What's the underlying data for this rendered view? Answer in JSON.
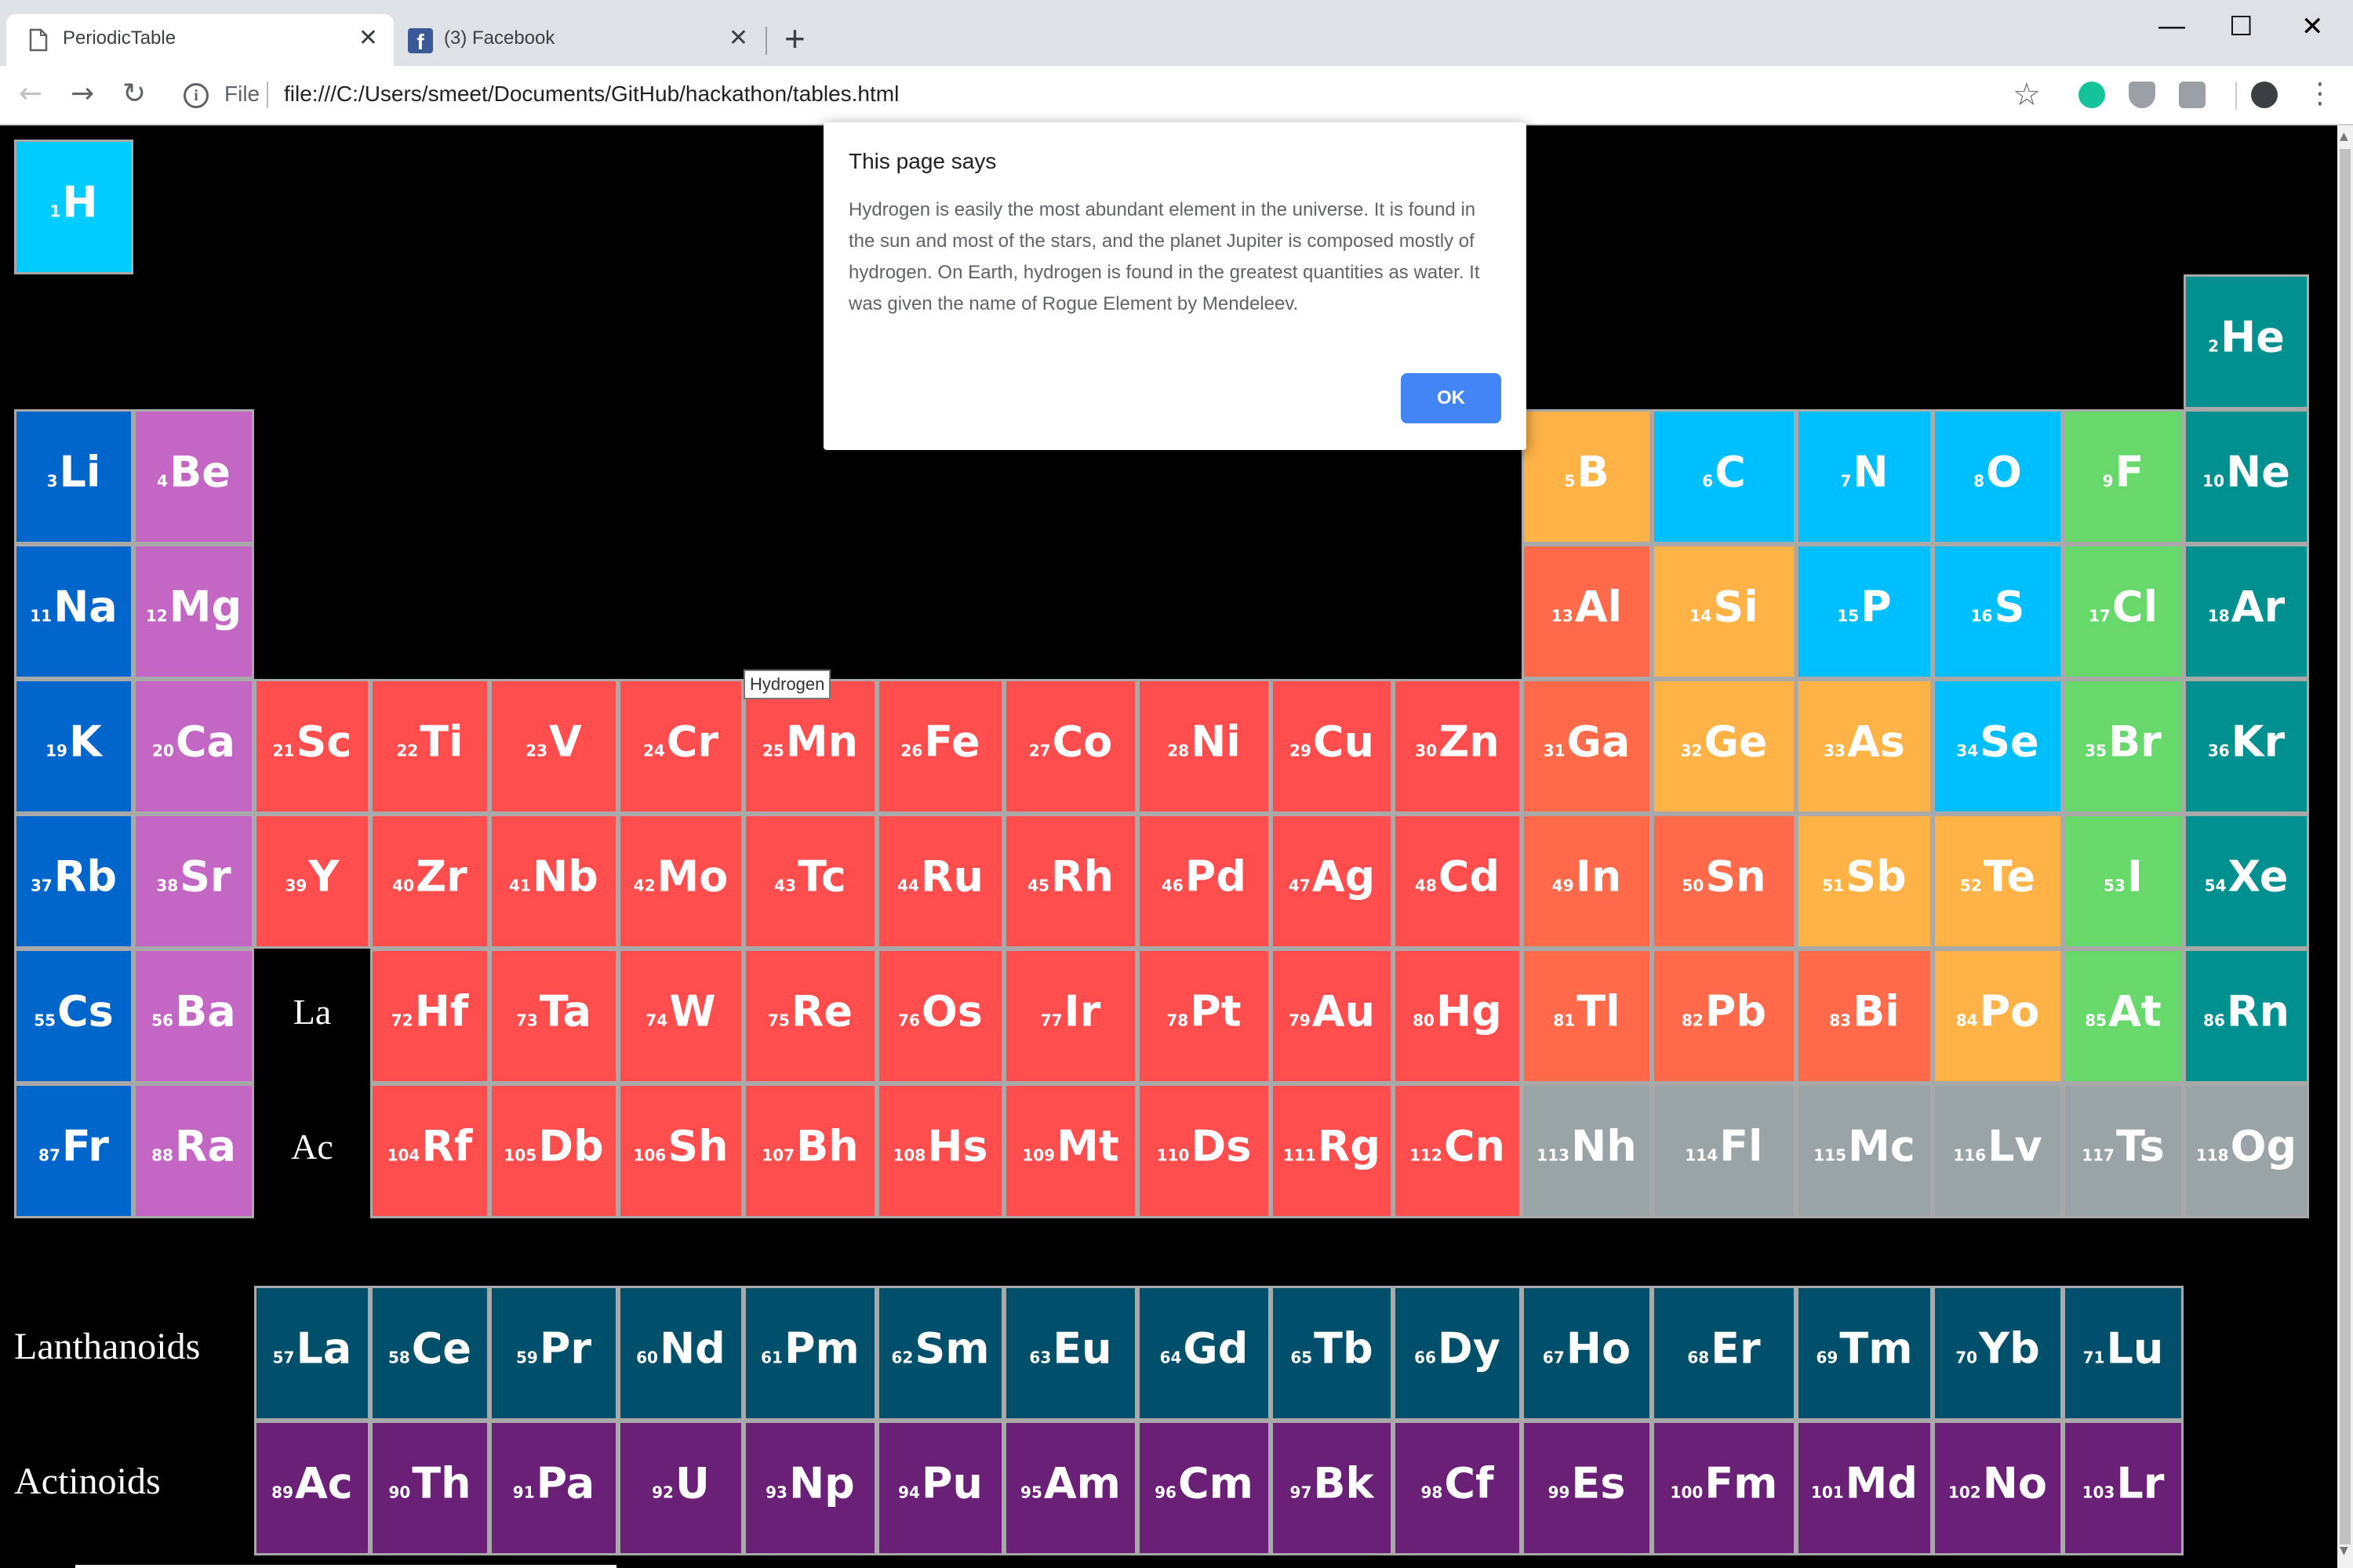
{
  "browser": {
    "tabs": [
      {
        "label": "PeriodicTable",
        "icon": "document-icon",
        "active": true
      },
      {
        "label": "(3) Facebook",
        "icon": "facebook-icon",
        "active": false
      }
    ],
    "new_tab": "+",
    "window_controls": {
      "minimize": "—",
      "maximize": "☐",
      "close": "✕"
    },
    "nav": {
      "back": "←",
      "forward": "→",
      "reload": "↻"
    },
    "address": {
      "scheme_label": "File",
      "url": "file:///C:/Users/smeet/Documents/GitHub/hackathon/tables.html"
    },
    "bookmark_star": "☆",
    "extensions": [
      "grammarly-icon",
      "shield-icon",
      "camera-icon",
      "profile-icon"
    ],
    "menu": "⋮"
  },
  "colors": {
    "alkali": "#0066cc",
    "alkaline": "#c466c4",
    "transition": "#ff4d4d",
    "post_transition": "#ff6b4a",
    "metalloid": "#ffb347",
    "nonmetal": "#00bfff",
    "halogen": "#66d96a",
    "noble": "#009090",
    "unknown": "#9aa3a6",
    "lanthanoid": "#00506b",
    "actinoid": "#6b2077",
    "hydrogen": "#00ccff"
  },
  "table": {
    "main": [
      {
        "row": 1,
        "col": 1,
        "n": "1",
        "s": "H",
        "c": "hydrogen"
      },
      {
        "row": 2,
        "col": 18,
        "n": "2",
        "s": "He",
        "c": "noble"
      },
      {
        "row": 3,
        "col": 1,
        "n": "3",
        "s": "Li",
        "c": "alkali"
      },
      {
        "row": 3,
        "col": 2,
        "n": "4",
        "s": "Be",
        "c": "alkaline"
      },
      {
        "row": 3,
        "col": 13,
        "n": "5",
        "s": "B",
        "c": "metalloid"
      },
      {
        "row": 3,
        "col": 14,
        "n": "6",
        "s": "C",
        "c": "nonmetal"
      },
      {
        "row": 3,
        "col": 15,
        "n": "7",
        "s": "N",
        "c": "nonmetal"
      },
      {
        "row": 3,
        "col": 16,
        "n": "8",
        "s": "O",
        "c": "nonmetal"
      },
      {
        "row": 3,
        "col": 17,
        "n": "9",
        "s": "F",
        "c": "halogen"
      },
      {
        "row": 3,
        "col": 18,
        "n": "10",
        "s": "Ne",
        "c": "noble"
      },
      {
        "row": 4,
        "col": 1,
        "n": "11",
        "s": "Na",
        "c": "alkali"
      },
      {
        "row": 4,
        "col": 2,
        "n": "12",
        "s": "Mg",
        "c": "alkaline"
      },
      {
        "row": 4,
        "col": 13,
        "n": "13",
        "s": "Al",
        "c": "post_transition"
      },
      {
        "row": 4,
        "col": 14,
        "n": "14",
        "s": "Si",
        "c": "metalloid"
      },
      {
        "row": 4,
        "col": 15,
        "n": "15",
        "s": "P",
        "c": "nonmetal"
      },
      {
        "row": 4,
        "col": 16,
        "n": "16",
        "s": "S",
        "c": "nonmetal"
      },
      {
        "row": 4,
        "col": 17,
        "n": "17",
        "s": "Cl",
        "c": "halogen"
      },
      {
        "row": 4,
        "col": 18,
        "n": "18",
        "s": "Ar",
        "c": "noble"
      },
      {
        "row": 5,
        "col": 1,
        "n": "19",
        "s": "K",
        "c": "alkali"
      },
      {
        "row": 5,
        "col": 2,
        "n": "20",
        "s": "Ca",
        "c": "alkaline"
      },
      {
        "row": 5,
        "col": 3,
        "n": "21",
        "s": "Sc",
        "c": "transition"
      },
      {
        "row": 5,
        "col": 4,
        "n": "22",
        "s": "Ti",
        "c": "transition"
      },
      {
        "row": 5,
        "col": 5,
        "n": "23",
        "s": "V",
        "c": "transition"
      },
      {
        "row": 5,
        "col": 6,
        "n": "24",
        "s": "Cr",
        "c": "transition"
      },
      {
        "row": 5,
        "col": 7,
        "n": "25",
        "s": "Mn",
        "c": "transition"
      },
      {
        "row": 5,
        "col": 8,
        "n": "26",
        "s": "Fe",
        "c": "transition"
      },
      {
        "row": 5,
        "col": 9,
        "n": "27",
        "s": "Co",
        "c": "transition"
      },
      {
        "row": 5,
        "col": 10,
        "n": "28",
        "s": "Ni",
        "c": "transition"
      },
      {
        "row": 5,
        "col": 11,
        "n": "29",
        "s": "Cu",
        "c": "transition"
      },
      {
        "row": 5,
        "col": 12,
        "n": "30",
        "s": "Zn",
        "c": "transition"
      },
      {
        "row": 5,
        "col": 13,
        "n": "31",
        "s": "Ga",
        "c": "post_transition"
      },
      {
        "row": 5,
        "col": 14,
        "n": "32",
        "s": "Ge",
        "c": "metalloid"
      },
      {
        "row": 5,
        "col": 15,
        "n": "33",
        "s": "As",
        "c": "metalloid"
      },
      {
        "row": 5,
        "col": 16,
        "n": "34",
        "s": "Se",
        "c": "nonmetal"
      },
      {
        "row": 5,
        "col": 17,
        "n": "35",
        "s": "Br",
        "c": "halogen"
      },
      {
        "row": 5,
        "col": 18,
        "n": "36",
        "s": "Kr",
        "c": "noble"
      },
      {
        "row": 6,
        "col": 1,
        "n": "37",
        "s": "Rb",
        "c": "alkali"
      },
      {
        "row": 6,
        "col": 2,
        "n": "38",
        "s": "Sr",
        "c": "alkaline"
      },
      {
        "row": 6,
        "col": 3,
        "n": "39",
        "s": "Y",
        "c": "transition"
      },
      {
        "row": 6,
        "col": 4,
        "n": "40",
        "s": "Zr",
        "c": "transition"
      },
      {
        "row": 6,
        "col": 5,
        "n": "41",
        "s": "Nb",
        "c": "transition"
      },
      {
        "row": 6,
        "col": 6,
        "n": "42",
        "s": "Mo",
        "c": "transition"
      },
      {
        "row": 6,
        "col": 7,
        "n": "43",
        "s": "Tc",
        "c": "transition"
      },
      {
        "row": 6,
        "col": 8,
        "n": "44",
        "s": "Ru",
        "c": "transition"
      },
      {
        "row": 6,
        "col": 9,
        "n": "45",
        "s": "Rh",
        "c": "transition"
      },
      {
        "row": 6,
        "col": 10,
        "n": "46",
        "s": "Pd",
        "c": "transition"
      },
      {
        "row": 6,
        "col": 11,
        "n": "47",
        "s": "Ag",
        "c": "transition"
      },
      {
        "row": 6,
        "col": 12,
        "n": "48",
        "s": "Cd",
        "c": "transition"
      },
      {
        "row": 6,
        "col": 13,
        "n": "49",
        "s": "In",
        "c": "post_transition"
      },
      {
        "row": 6,
        "col": 14,
        "n": "50",
        "s": "Sn",
        "c": "post_transition"
      },
      {
        "row": 6,
        "col": 15,
        "n": "51",
        "s": "Sb",
        "c": "metalloid"
      },
      {
        "row": 6,
        "col": 16,
        "n": "52",
        "s": "Te",
        "c": "metalloid"
      },
      {
        "row": 6,
        "col": 17,
        "n": "53",
        "s": "I",
        "c": "halogen"
      },
      {
        "row": 6,
        "col": 18,
        "n": "54",
        "s": "Xe",
        "c": "noble"
      },
      {
        "row": 7,
        "col": 1,
        "n": "55",
        "s": "Cs",
        "c": "alkali"
      },
      {
        "row": 7,
        "col": 2,
        "n": "56",
        "s": "Ba",
        "c": "alkaline"
      },
      {
        "row": 7,
        "col": 4,
        "n": "72",
        "s": "Hf",
        "c": "transition"
      },
      {
        "row": 7,
        "col": 5,
        "n": "73",
        "s": "Ta",
        "c": "transition"
      },
      {
        "row": 7,
        "col": 6,
        "n": "74",
        "s": "W",
        "c": "transition"
      },
      {
        "row": 7,
        "col": 7,
        "n": "75",
        "s": "Re",
        "c": "transition"
      },
      {
        "row": 7,
        "col": 8,
        "n": "76",
        "s": "Os",
        "c": "transition"
      },
      {
        "row": 7,
        "col": 9,
        "n": "77",
        "s": "Ir",
        "c": "transition"
      },
      {
        "row": 7,
        "col": 10,
        "n": "78",
        "s": "Pt",
        "c": "transition"
      },
      {
        "row": 7,
        "col": 11,
        "n": "79",
        "s": "Au",
        "c": "transition"
      },
      {
        "row": 7,
        "col": 12,
        "n": "80",
        "s": "Hg",
        "c": "transition"
      },
      {
        "row": 7,
        "col": 13,
        "n": "81",
        "s": "Tl",
        "c": "post_transition"
      },
      {
        "row": 7,
        "col": 14,
        "n": "82",
        "s": "Pb",
        "c": "post_transition"
      },
      {
        "row": 7,
        "col": 15,
        "n": "83",
        "s": "Bi",
        "c": "post_transition"
      },
      {
        "row": 7,
        "col": 16,
        "n": "84",
        "s": "Po",
        "c": "metalloid"
      },
      {
        "row": 7,
        "col": 17,
        "n": "85",
        "s": "At",
        "c": "halogen"
      },
      {
        "row": 7,
        "col": 18,
        "n": "86",
        "s": "Rn",
        "c": "noble"
      },
      {
        "row": 8,
        "col": 1,
        "n": "87",
        "s": "Fr",
        "c": "alkali"
      },
      {
        "row": 8,
        "col": 2,
        "n": "88",
        "s": "Ra",
        "c": "alkaline"
      },
      {
        "row": 8,
        "col": 4,
        "n": "104",
        "s": "Rf",
        "c": "transition"
      },
      {
        "row": 8,
        "col": 5,
        "n": "105",
        "s": "Db",
        "c": "transition"
      },
      {
        "row": 8,
        "col": 6,
        "n": "106",
        "s": "Sh",
        "c": "transition"
      },
      {
        "row": 8,
        "col": 7,
        "n": "107",
        "s": "Bh",
        "c": "transition"
      },
      {
        "row": 8,
        "col": 8,
        "n": "108",
        "s": "Hs",
        "c": "transition"
      },
      {
        "row": 8,
        "col": 9,
        "n": "109",
        "s": "Mt",
        "c": "transition"
      },
      {
        "row": 8,
        "col": 10,
        "n": "110",
        "s": "Ds",
        "c": "transition"
      },
      {
        "row": 8,
        "col": 11,
        "n": "111",
        "s": "Rg",
        "c": "transition"
      },
      {
        "row": 8,
        "col": 12,
        "n": "112",
        "s": "Cn",
        "c": "transition"
      },
      {
        "row": 8,
        "col": 13,
        "n": "113",
        "s": "Nh",
        "c": "unknown"
      },
      {
        "row": 8,
        "col": 14,
        "n": "114",
        "s": "Fl",
        "c": "unknown"
      },
      {
        "row": 8,
        "col": 15,
        "n": "115",
        "s": "Mc",
        "c": "unknown"
      },
      {
        "row": 8,
        "col": 16,
        "n": "116",
        "s": "Lv",
        "c": "unknown"
      },
      {
        "row": 8,
        "col": 17,
        "n": "117",
        "s": "Ts",
        "c": "unknown"
      },
      {
        "row": 8,
        "col": 18,
        "n": "118",
        "s": "Og",
        "c": "unknown"
      }
    ],
    "placeholders": [
      {
        "row": 7,
        "col": 3,
        "text": "La"
      },
      {
        "row": 8,
        "col": 3,
        "text": "Ac"
      }
    ],
    "series_labels": {
      "lanthanoids": "Lanthanoids",
      "actinoids": "Actinoids"
    },
    "lanthanoids": [
      {
        "n": "57",
        "s": "La"
      },
      {
        "n": "58",
        "s": "Ce"
      },
      {
        "n": "59",
        "s": "Pr"
      },
      {
        "n": "60",
        "s": "Nd"
      },
      {
        "n": "61",
        "s": "Pm"
      },
      {
        "n": "62",
        "s": "Sm"
      },
      {
        "n": "63",
        "s": "Eu"
      },
      {
        "n": "64",
        "s": "Gd"
      },
      {
        "n": "65",
        "s": "Tb"
      },
      {
        "n": "66",
        "s": "Dy"
      },
      {
        "n": "67",
        "s": "Ho"
      },
      {
        "n": "68",
        "s": "Er"
      },
      {
        "n": "69",
        "s": "Tm"
      },
      {
        "n": "70",
        "s": "Yb"
      },
      {
        "n": "71",
        "s": "Lu"
      }
    ],
    "actinoids": [
      {
        "n": "89",
        "s": "Ac"
      },
      {
        "n": "90",
        "s": "Th"
      },
      {
        "n": "91",
        "s": "Pa"
      },
      {
        "n": "92",
        "s": "U"
      },
      {
        "n": "93",
        "s": "Np"
      },
      {
        "n": "94",
        "s": "Pu"
      },
      {
        "n": "95",
        "s": "Am"
      },
      {
        "n": "96",
        "s": "Cm"
      },
      {
        "n": "97",
        "s": "Bk"
      },
      {
        "n": "98",
        "s": "Cf"
      },
      {
        "n": "99",
        "s": "Es"
      },
      {
        "n": "100",
        "s": "Fm"
      },
      {
        "n": "101",
        "s": "Md"
      },
      {
        "n": "102",
        "s": "No"
      },
      {
        "n": "103",
        "s": "Lr"
      }
    ]
  },
  "tooltip": "Hydrogen",
  "dialog": {
    "title": "This page says",
    "message": "Hydrogen is easily the most abundant element in the universe. It is found in the sun and most of the stars, and the planet Jupiter is composed mostly of hydrogen. On Earth, hydrogen is found in the greatest quantities as water. It was given the name of Rogue Element by Mendeleev.",
    "ok_label": "OK"
  }
}
